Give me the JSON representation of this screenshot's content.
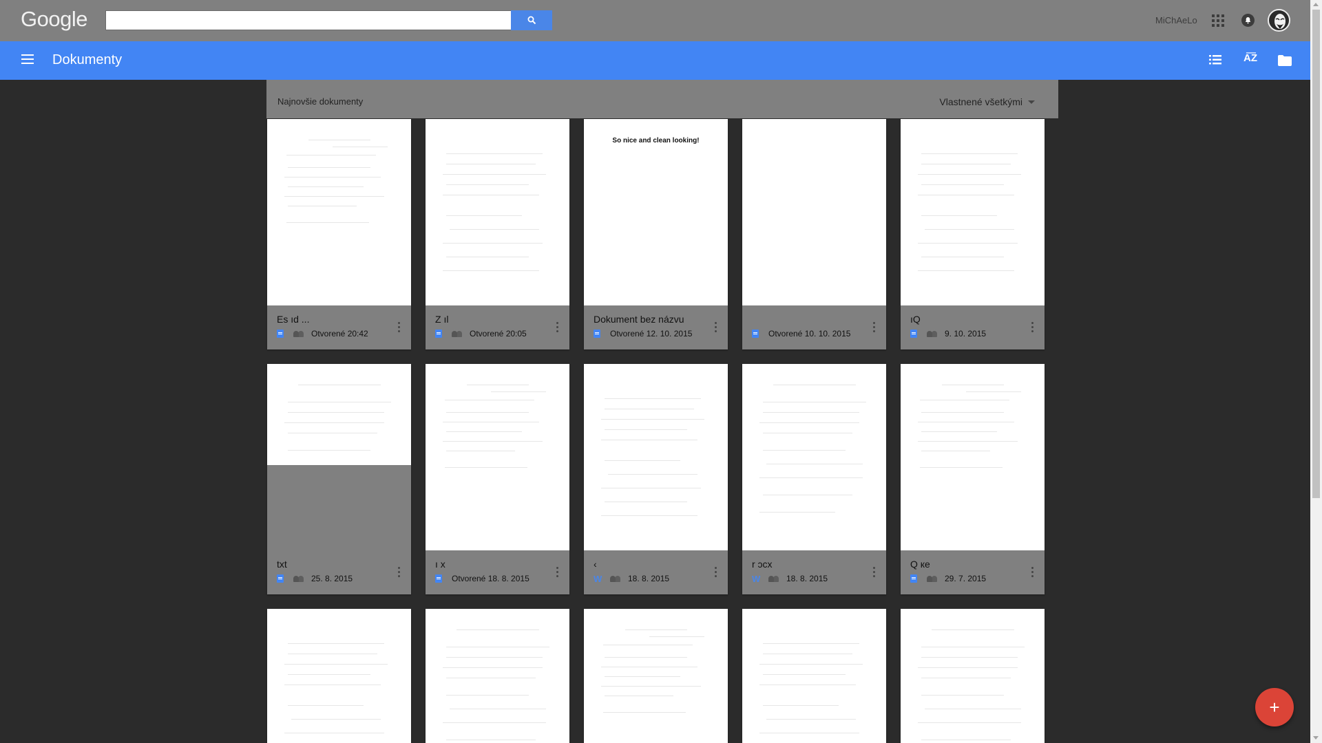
{
  "topbar": {
    "logo": "Google",
    "search_placeholder": "",
    "user_name": "MiChAeLo"
  },
  "appbar": {
    "title": "Dokumenty"
  },
  "section": {
    "title": "Najnovšie dokumenty",
    "owner_filter": "Vlastnené všetkými"
  },
  "documents": [
    {
      "title": "Es                    ıd ...",
      "meta": "Otvorené 20:42",
      "file_icon": "docs-icon",
      "shared": true,
      "thumb": "text"
    },
    {
      "title": "Z                ıl",
      "meta": "Otvorené 20:05",
      "file_icon": "docs-icon",
      "shared": true,
      "thumb": "text"
    },
    {
      "title": "Dokument bez názvu",
      "meta": "Otvorené 12. 10. 2015",
      "file_icon": "docs-icon",
      "shared": false,
      "thumb": "heading",
      "thumb_heading": "So nice and clean looking!"
    },
    {
      "title": "",
      "meta": "Otvorené 10. 10. 2015",
      "file_icon": "docs-icon",
      "shared": false,
      "thumb": "blank"
    },
    {
      "title": "                           ıQ",
      "meta": "9. 10. 2015",
      "file_icon": "docs-icon",
      "shared": true,
      "thumb": "text"
    },
    {
      "title": "                 txt",
      "meta": "25. 8. 2015",
      "file_icon": "docs-icon",
      "shared": true,
      "thumb": "short"
    },
    {
      "title": "ı                   x",
      "meta": "Otvorené 18. 8. 2015",
      "file_icon": "docs-icon",
      "shared": false,
      "thumb": "text"
    },
    {
      "title": "                      ‹",
      "meta": "18. 8. 2015",
      "file_icon": "word-icon",
      "shared": true,
      "thumb": "text"
    },
    {
      "title": "r               ɔcx",
      "meta": "18. 8. 2015",
      "file_icon": "word-icon",
      "shared": true,
      "thumb": "text"
    },
    {
      "title": "Q                                 ке",
      "meta": "29. 7. 2015",
      "file_icon": "docs-icon",
      "shared": true,
      "thumb": "text"
    },
    {
      "title": "",
      "meta": "",
      "file_icon": "",
      "shared": false,
      "thumb": "text"
    },
    {
      "title": "",
      "meta": "",
      "file_icon": "",
      "shared": false,
      "thumb": "text"
    },
    {
      "title": "",
      "meta": "",
      "file_icon": "",
      "shared": false,
      "thumb": "text"
    },
    {
      "title": "",
      "meta": "",
      "file_icon": "",
      "shared": false,
      "thumb": "text"
    },
    {
      "title": "",
      "meta": "",
      "file_icon": "",
      "shared": false,
      "thumb": "text"
    }
  ],
  "fab": {
    "label": "+"
  },
  "colors": {
    "appbar": "#4285f4",
    "topbar": "#808080",
    "fab": "#db4437"
  }
}
